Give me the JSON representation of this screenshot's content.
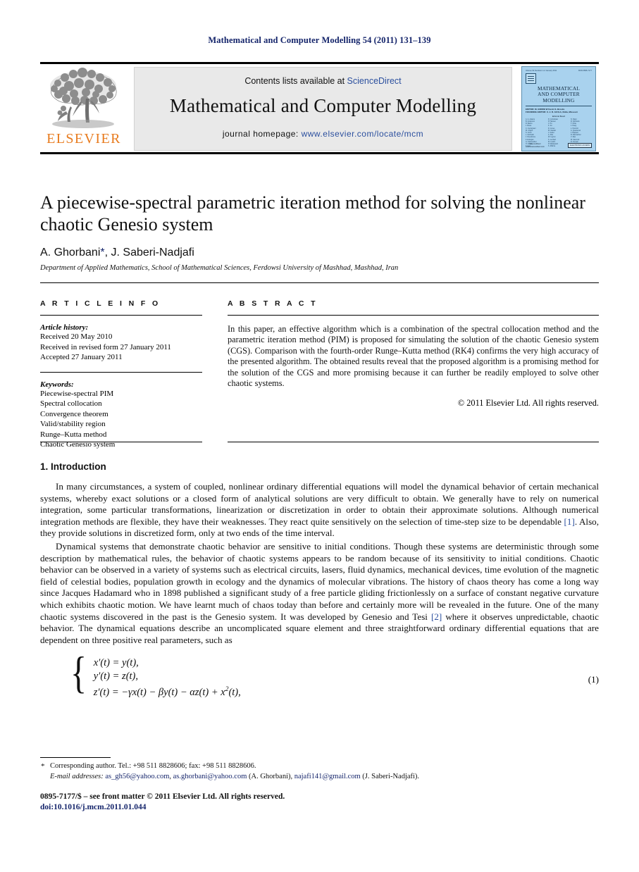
{
  "running_head": "Mathematical and Computer Modelling 54 (2011) 131–139",
  "masthead": {
    "contents_prefix": "Contents lists available at ",
    "contents_link": "ScienceDirect",
    "journal_title": "Mathematical and Computer Modelling",
    "homepage_prefix": "journal homepage: ",
    "homepage_link": "www.elsevier.com/locate/mcm",
    "publisher_wordmark": "ELSEVIER"
  },
  "cover": {
    "volume_line": "Volume 54 Numbers 1-2  January 2011",
    "issn_line": "ISSN 0895-7177",
    "title_line_1": "MATHEMATICAL",
    "title_line_2": "AND COMPUTER",
    "title_line_3": "MODELLING",
    "editor_1": "EDITOR: Dr ANDRE W Kevin S. Brooks",
    "editor_2": "FOUNDING EDITOR: X. J. R. AVULA, Rolla, Missouri",
    "board_title": "Editorial Board",
    "board_col_1": [
      "A. A. Adams",
      "B. Anderson",
      "R. Barrio",
      "J. Bona",
      "C. Cercignani",
      "M. Chipot",
      "S. Cohn",
      "L. Debnath",
      "J. Dieudonne",
      "F. Erdogan",
      "G. Fairweather",
      "H. Frank",
      "T. Gao"
    ],
    "board_col_2": [
      "R. Grimshaw",
      "P. Hansen",
      "J. Hu",
      "K. Ito",
      "D. Jones",
      "M. Kawski",
      "L. Keller",
      "A. Klar",
      "W. Layton",
      "S. Lenhart",
      "M. Luskin",
      "P. Markowich",
      "S. Mishra"
    ],
    "board_col_3": [
      "N. Nigro",
      "R. Nochetto",
      "T. Ohta",
      "J. Pang",
      "L. Petzold",
      "A. Quarteroni",
      "J. Rappaz",
      "R. Rannacher",
      "V. Rao",
      "M. Slemrod",
      "R. Temam",
      "L. Vandewalle",
      "Z. Zhang"
    ],
    "badge_1": "ELECTRONIC ACCESS",
    "badge_2": "ScienceDirect",
    "badge_3": "www.sciencedirect.com"
  },
  "article": {
    "title": "A piecewise-spectral parametric iteration method for solving the nonlinear chaotic Genesio system",
    "authors": "A. Ghorbani",
    "author_star": "*",
    "authors_rest": ", J. Saberi-Nadjafi",
    "affiliation": "Department of Applied Mathematics, School of Mathematical Sciences, Ferdowsi University of Mashhad, Mashhad, Iran"
  },
  "article_info": {
    "label": "A R T I C L E    I N F O",
    "history_heading": "Article history:",
    "history": [
      "Received 20 May 2010",
      "Received in revised form 27 January 2011",
      "Accepted 27 January 2011"
    ],
    "keywords_heading": "Keywords:",
    "keywords": [
      "Piecewise-spectral PIM",
      "Spectral collocation",
      "Convergence theorem",
      "Valid/stability region",
      "Runge–Kutta method",
      "Chaotic Genesio system"
    ]
  },
  "abstract": {
    "label": "A B S T R A C T",
    "text": "In this paper, an effective algorithm which is a combination of the spectral collocation method and the parametric iteration method (PIM) is proposed for simulating the solution of the chaotic Genesio system (CGS). Comparison with the fourth-order Runge–Kutta method (RK4) confirms the very high accuracy of the presented algorithm. The obtained results reveal that the proposed algorithm is a promising method for the solution of the CGS and more promising because it can further be readily employed to solve other chaotic systems.",
    "copyright": "© 2011 Elsevier Ltd. All rights reserved."
  },
  "body": {
    "section_heading": "1.  Introduction",
    "paragraph_1_a": "In many circumstances, a system of coupled, nonlinear ordinary differential equations will model the dynamical behavior of certain mechanical systems, whereby exact solutions or a closed form of analytical solutions are very difficult to obtain. We generally have to rely on numerical integration, some particular transformations, linearization or discretization in order to obtain their approximate solutions. Although numerical integration methods are flexible, they have their weaknesses. They react quite sensitively on the selection of time-step size to be dependable ",
    "paragraph_1_cite": "[1]",
    "paragraph_1_b": ". Also, they provide solutions in discretized form, only at two ends of the time interval.",
    "paragraph_2_a": "Dynamical systems that demonstrate chaotic behavior are sensitive to initial conditions. Though these systems are deterministic through some description by mathematical rules, the behavior of chaotic systems appears to be random because of its sensitivity to initial conditions. Chaotic behavior can be observed in a variety of systems such as electrical circuits, lasers, fluid dynamics, mechanical devices, time evolution of the magnetic field of celestial bodies, population growth in ecology and the dynamics of molecular vibrations. The history of chaos theory has come a long way since Jacques Hadamard who in 1898 published a significant study of a free particle gliding frictionlessly on a surface of constant negative curvature which exhibits chaotic motion. We have learnt much of chaos today than before and certainly more will be revealed in the future. One of the many chaotic systems discovered in the past is the Genesio system. It was developed by Genesio and Tesi ",
    "paragraph_2_cite": "[2]",
    "paragraph_2_b": " where it observes unpredictable, chaotic behavior. The dynamical equations describe an uncomplicated square element and three straightforward ordinary differential equations that are dependent on three positive real parameters, such as"
  },
  "equation": {
    "line_1": "x′(t) = y(t),",
    "line_2": "y′(t) = z(t),",
    "line_3_pre": "z′(t) = −γx(t) − βy(t) − αz(t) + x",
    "line_3_sup": "2",
    "line_3_post": "(t),",
    "number": "(1)"
  },
  "footnotes": {
    "corresponding": "Corresponding author. Tel.: +98 511 8828606; fax: +98 511 8828606.",
    "email_label": "E-mail addresses:",
    "email_1": "as_gh56@yahoo.com",
    "email_sep_1": ", ",
    "email_2": "as.ghorbani@yahoo.com",
    "email_attr_1": " (A. Ghorbani), ",
    "email_3": "najafi141@gmail.com",
    "email_attr_2": " (J. Saberi-Nadjafi)."
  },
  "footer": {
    "issn_line": "0895-7177/$ – see front matter © 2011 Elsevier Ltd. All rights reserved.",
    "doi": "doi:10.1016/j.mcm.2011.01.044"
  },
  "colors": {
    "navy": "#15256b",
    "link_blue": "#2b4f9e",
    "elsevier_orange": "#e87b1e",
    "masthead_gray": "#e9e9e9",
    "cover_blue": "#a9d2ee"
  }
}
